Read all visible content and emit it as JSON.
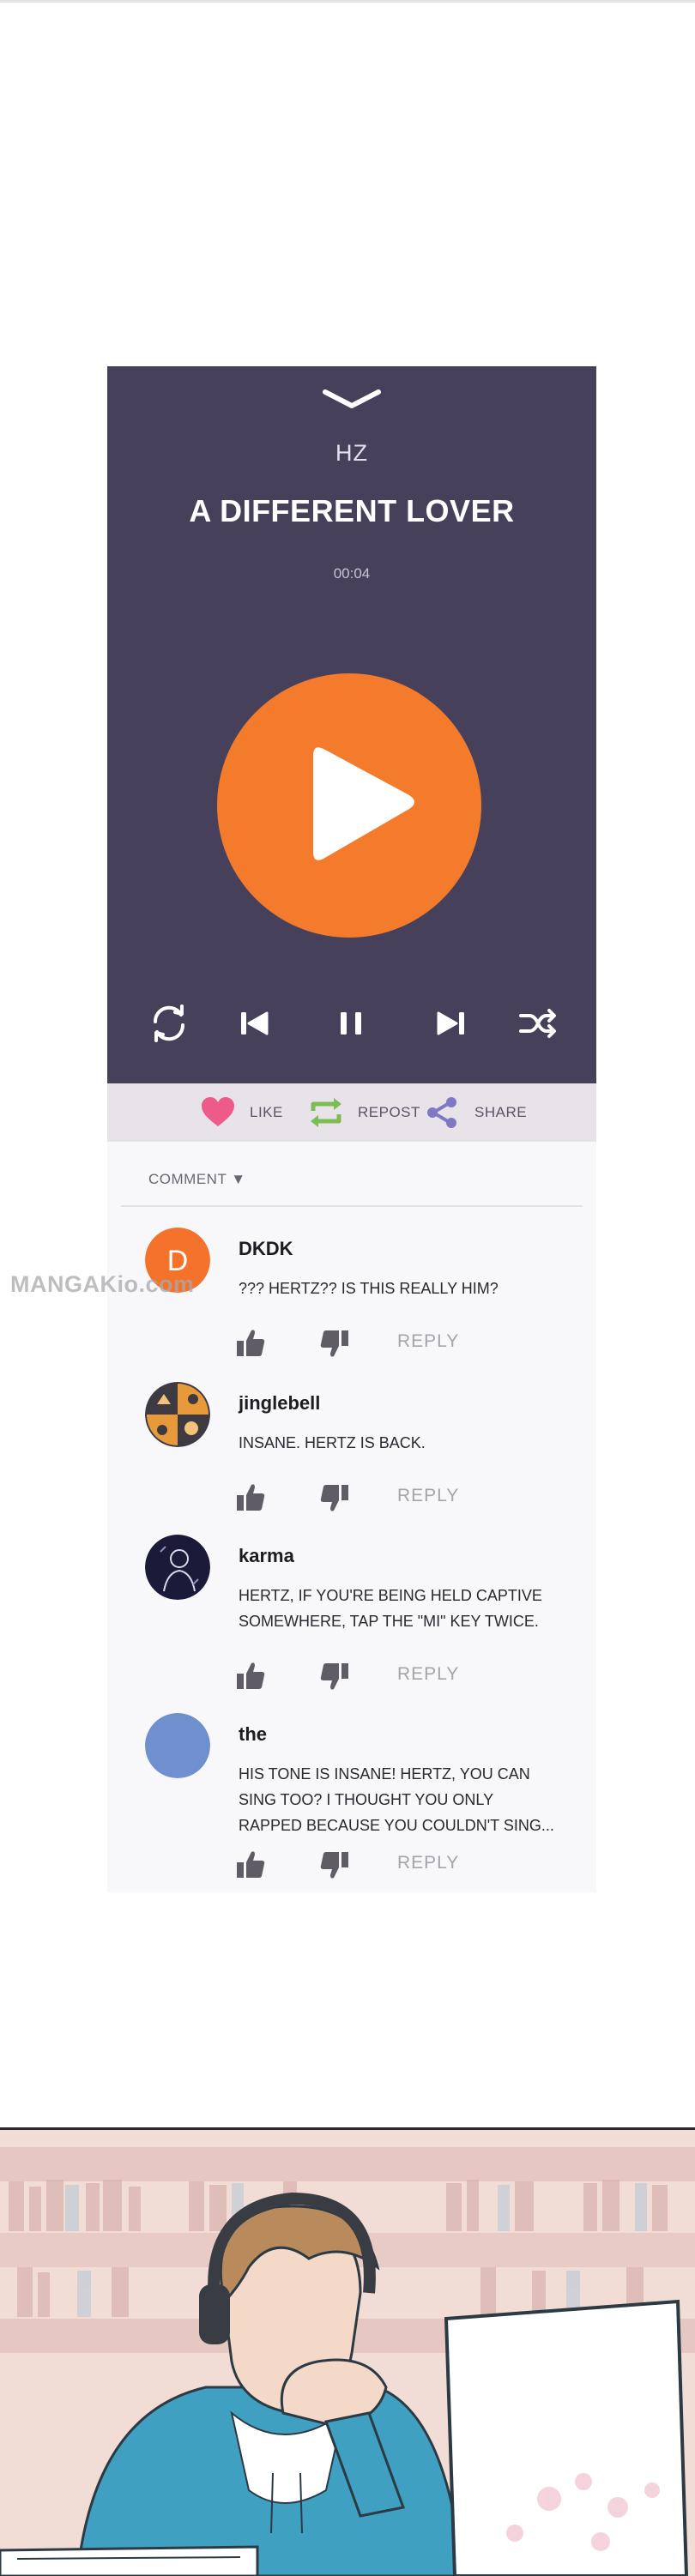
{
  "player": {
    "artist": "HZ",
    "title": "A DIFFERENT LOVER",
    "time": "00:04",
    "accent_color": "#f47a2c",
    "background_color": "#46405a",
    "icons": [
      "collapse-chevron-icon",
      "play-icon",
      "repeat-icon",
      "previous-icon",
      "pause-icon",
      "next-icon",
      "shuffle-icon"
    ]
  },
  "actions": {
    "like_label": "LIKE",
    "repost_label": "REPOST",
    "share_label": "SHARE",
    "like_color": "#ee5a8a",
    "repost_color": "#7dbb55",
    "share_color": "#7f78c4"
  },
  "comments": {
    "sort_label": "COMMENT ▼",
    "reply_label": "REPLY",
    "items": [
      {
        "username": "DKDK",
        "avatar_letter": "D",
        "avatar_color": "#f4722a",
        "lines": [
          "??? HERTZ?? IS THIS REALLY HIM?"
        ]
      },
      {
        "username": "jinglebell",
        "avatar_color": "#3d3a42",
        "lines": [
          "INSANE. HERTZ IS BACK."
        ]
      },
      {
        "username": "karma",
        "avatar_color": "#1b1a38",
        "lines": [
          "HERTZ, IF YOU'RE BEING HELD CAPTIVE",
          "SOMEWHERE, TAP THE \"MI\" KEY TWICE."
        ]
      },
      {
        "username": "the",
        "avatar_color": "#6f8fcf",
        "lines": [
          "HIS TONE IS INSANE! HERTZ, YOU CAN",
          "SING TOO? I THOUGHT YOU ONLY",
          "RAPPED BECAUSE YOU COULDN'T SING..."
        ]
      }
    ]
  },
  "watermark": "MANGAKio.com"
}
